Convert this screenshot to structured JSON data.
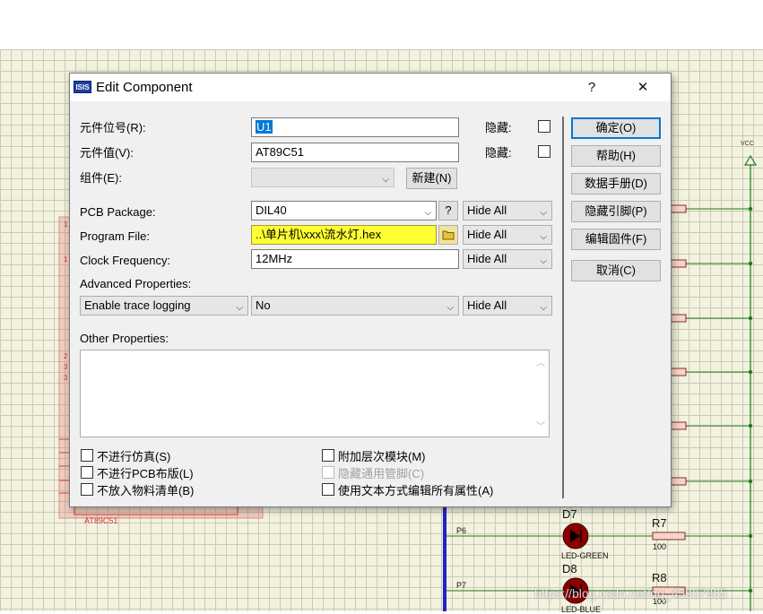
{
  "dialog": {
    "title": "Edit Component",
    "help_glyph": "?",
    "close_glyph": "✕",
    "icon_text": "ISIS",
    "fields": {
      "ref_label": "元件位号(R):",
      "ref_value": "U1",
      "value_label": "元件值(V):",
      "value_value": "AT89C51",
      "group_label": "组件(E):",
      "new_button": "新建(N)",
      "hidden_label": "隐藏:"
    },
    "props": {
      "pcb_label": "PCB Package:",
      "pcb_value": "DIL40",
      "pcb_help": "?",
      "program_label": "Program File:",
      "program_value": "..\\单片机\\xxx\\流水灯.hex",
      "clock_label": "Clock Frequency:",
      "clock_value": "12MHz",
      "advanced_label": "Advanced Properties:",
      "advanced_select": "Enable trace logging",
      "advanced_value": "No",
      "hide_all": "Hide All",
      "other_label": "Other Properties:"
    },
    "buttons": {
      "ok": "确定(O)",
      "help": "帮助(H)",
      "datasheet": "数据手册(D)",
      "hide_pins": "隐藏引脚(P)",
      "edit_firmware": "编辑固件(F)",
      "cancel": "取消(C)"
    },
    "checkboxes": {
      "exclude_sim": "不进行仿真(S)",
      "exclude_pcb": "不进行PCB布版(L)",
      "exclude_bom": "不放入物料清单(B)",
      "attach_hier": "附加层次模块(M)",
      "hide_common_pins": "隐藏通用管脚(C)",
      "edit_text": "使用文本方式编辑所有属性(A)"
    }
  },
  "schematic": {
    "chip_label": "AT89C51",
    "vcc": "VCC",
    "d7": "D7",
    "d8": "D8",
    "led7": "LED-GREEN",
    "led8": "LED-BLUE",
    "r7": "R7",
    "r8": "R8",
    "r_val": "100",
    "p6": "P6",
    "p7": "P7",
    "pin_numbers": [
      "1",
      "1",
      "2",
      "3",
      "3"
    ]
  },
  "watermark": "https://blog.csdn.net/qq_45907965"
}
